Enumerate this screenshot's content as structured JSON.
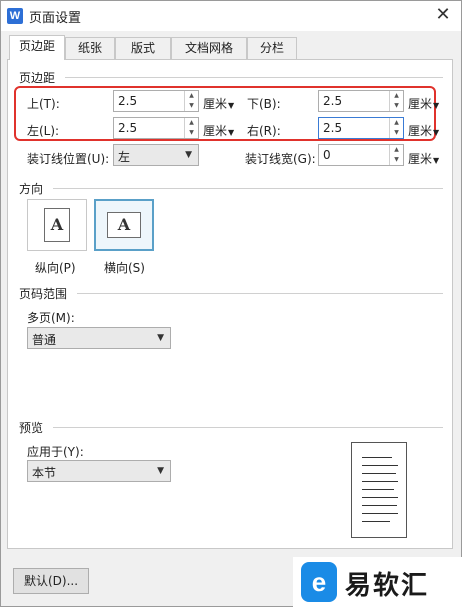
{
  "window": {
    "title": "页面设置",
    "app_icon_letter": "W",
    "close_glyph": "✕"
  },
  "tabs": [
    {
      "label": "页边距",
      "active": true
    },
    {
      "label": "纸张",
      "active": false
    },
    {
      "label": "版式",
      "active": false
    },
    {
      "label": "文档网格",
      "active": false
    },
    {
      "label": "分栏",
      "active": false
    }
  ],
  "margins": {
    "section_title": "页边距",
    "top": {
      "label": "上(T):",
      "value": "2.5",
      "unit": "厘米"
    },
    "bottom": {
      "label": "下(B):",
      "value": "2.5",
      "unit": "厘米"
    },
    "left": {
      "label": "左(L):",
      "value": "2.5",
      "unit": "厘米"
    },
    "right": {
      "label": "右(R):",
      "value": "2.5",
      "unit": "厘米"
    },
    "gutter_position": {
      "label": "装订线位置(U):",
      "value": "左"
    },
    "gutter_width": {
      "label": "装订线宽(G):",
      "value": "0",
      "unit": "厘米"
    }
  },
  "orientation": {
    "section_title": "方向",
    "portrait": {
      "label": "纵向(P)",
      "glyph": "A"
    },
    "landscape": {
      "label": "横向(S)",
      "glyph": "A",
      "selected": true
    }
  },
  "page_range": {
    "section_title": "页码范围",
    "multi_label": "多页(M):",
    "multi_value": "普通"
  },
  "preview": {
    "section_title": "预览",
    "apply_label": "应用于(Y):",
    "apply_value": "本节"
  },
  "footer": {
    "default_button": "默认(D)..."
  },
  "watermark": {
    "logo_glyph": "e",
    "text": "易软汇"
  },
  "colors": {
    "highlight_box": "#e0322c",
    "selected_orientation": "#5aa0c8",
    "app_icon": "#2d6fd6"
  }
}
